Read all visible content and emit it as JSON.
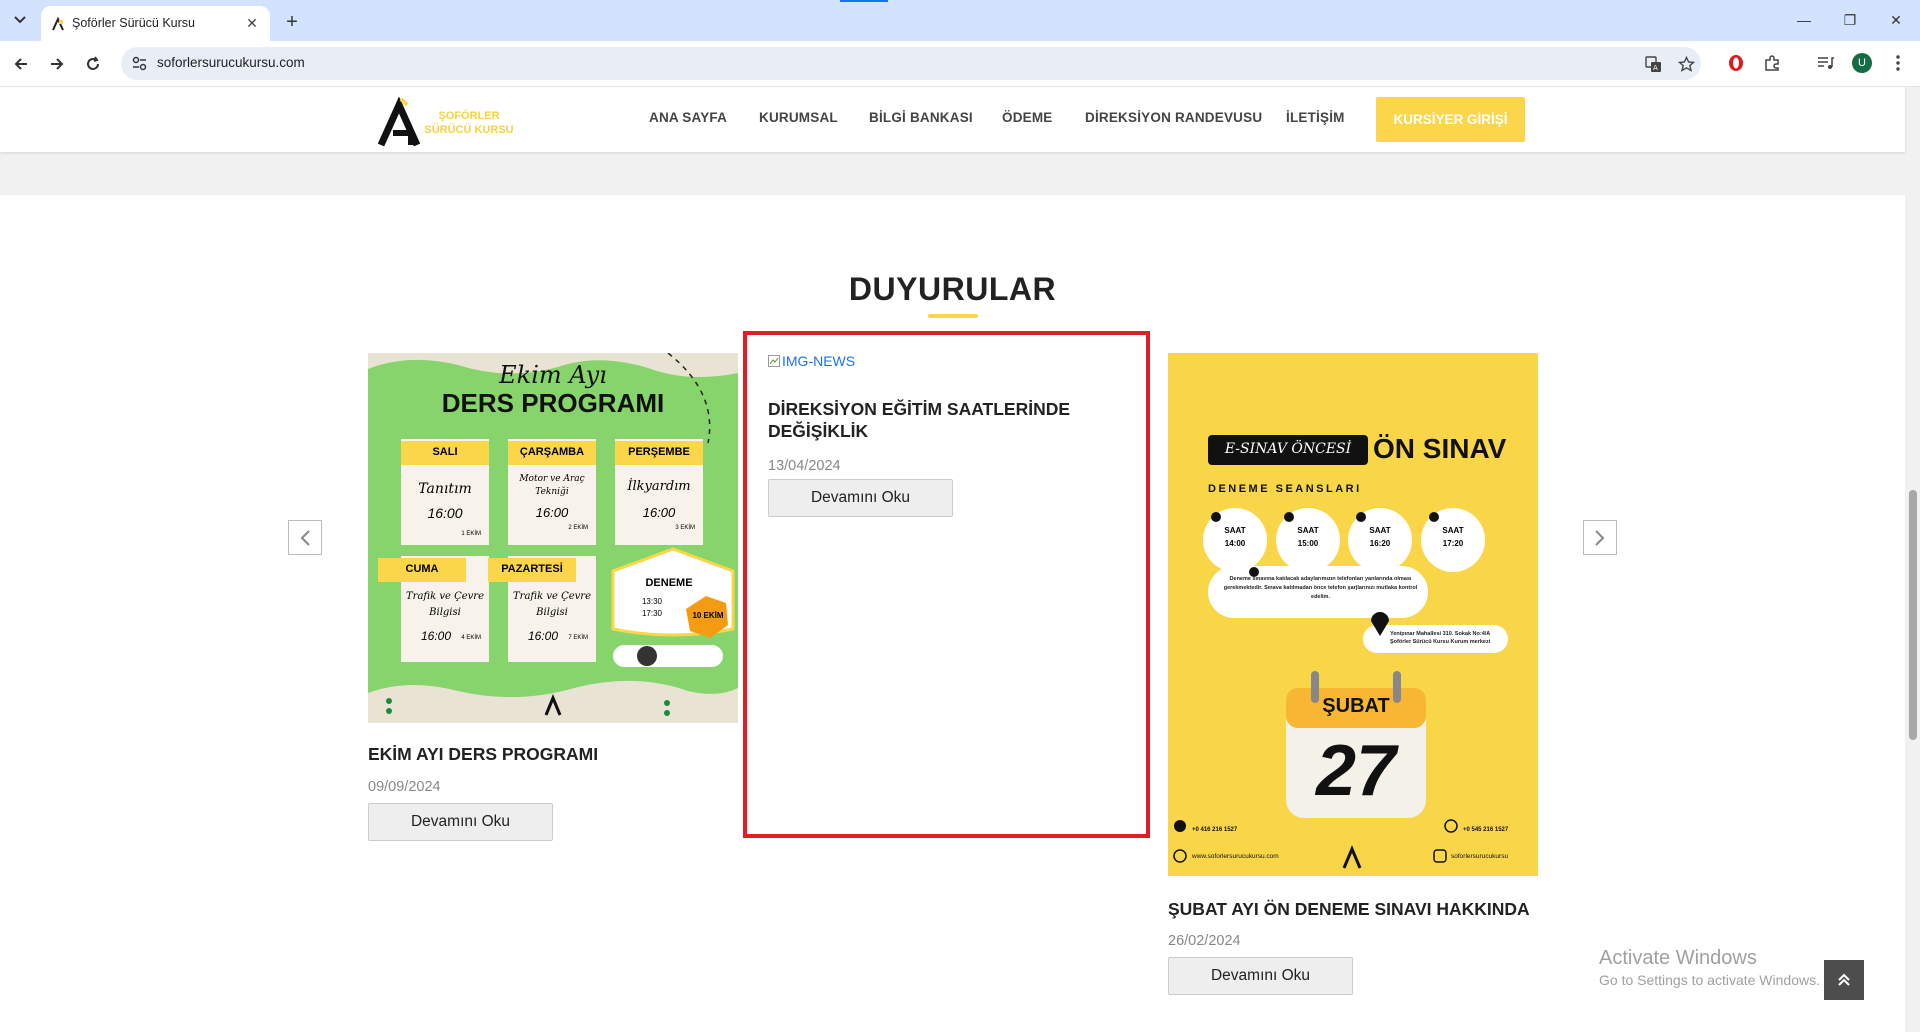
{
  "browser": {
    "tab_title": "Şoförler Sürücü Kursu",
    "url": "soforlersurucukursu.com",
    "profile_initial": "U"
  },
  "site": {
    "logo_text": "ŞOFÖRLER SÜRÜCÜ KURSU",
    "menu": [
      "ANA SAYFA",
      "KURUMSAL",
      "BİLGİ BANKASI",
      "ÖDEME",
      "DİREKSİYON RANDEVUSU",
      "İLETİŞİM"
    ],
    "login_label": "KURSİYER GİRİŞİ",
    "accent_color": "#fbd64a"
  },
  "announcements": {
    "section_title": "DUYURULAR",
    "read_more_label": "Devamını Oku",
    "items": [
      {
        "title": "EKİM AYI DERS PROGRAMI",
        "date": "09/09/2024",
        "poster": {
          "heading_script": "Ekim Ayı",
          "heading": "DERS PROGRAMI",
          "days": [
            {
              "day": "SALI",
              "topic": "Tanıtım",
              "time": "16:00",
              "date": "1 EKİM"
            },
            {
              "day": "ÇARŞAMBA",
              "topic": "Motor ve Araç Tekniği",
              "time": "16:00",
              "date": "2 EKİM"
            },
            {
              "day": "PERŞEMBE",
              "topic": "İlkyardım",
              "time": "16:00",
              "date": "3 EKİM"
            },
            {
              "day": "CUMA",
              "topic": "Trafik ve Çevre Bilgisi",
              "time": "16:00",
              "date": "4 EKİM"
            },
            {
              "day": "PAZARTESİ",
              "topic": "Trafik ve Çevre Bilgisi",
              "time": "16:00",
              "date": "7 EKİM"
            }
          ],
          "exam_label": "DENEME",
          "exam_times": [
            "13:30",
            "17:30"
          ],
          "exam_date": "10 EKİM"
        }
      },
      {
        "title": "DİREKSİYON EĞİTİM SAATLERİNDE DEĞİŞİKLİK",
        "date": "13/04/2024",
        "image_alt": "IMG-NEWS"
      },
      {
        "title": "ŞUBAT AYI ÖN DENEME SINAVI HAKKINDA",
        "date": "26/02/2024",
        "poster": {
          "tag": "E-SINAV ÖNCESİ",
          "heading": "ÖN SINAV",
          "subheading": "DENEME SEANSLARI",
          "sessions": [
            "14:00",
            "15:00",
            "16:20",
            "17:20"
          ],
          "session_label": "SAAT",
          "month": "ŞUBAT",
          "day": "27",
          "note": "Deneme sınavına katılacak adaylarımızın telefonları yanlarında olması gerekmektedir. Sınava katılmadan önce telefon şarjlarınızı mutlaka kontrol edelim.",
          "address": "Yenipınar Mahallesi 310. Sokak No:4/A Şoförler Sürücü Kursu Kurum merkezi",
          "phone_left": "+0 416 216 1527",
          "phone_right": "+0 545 216 1527",
          "website": "www.soforlersurucukursu.com",
          "instagram": "soforlersurucukursu"
        }
      }
    ]
  },
  "windows_notice": {
    "line1": "Activate Windows",
    "line2": "Go to Settings to activate Windows."
  }
}
